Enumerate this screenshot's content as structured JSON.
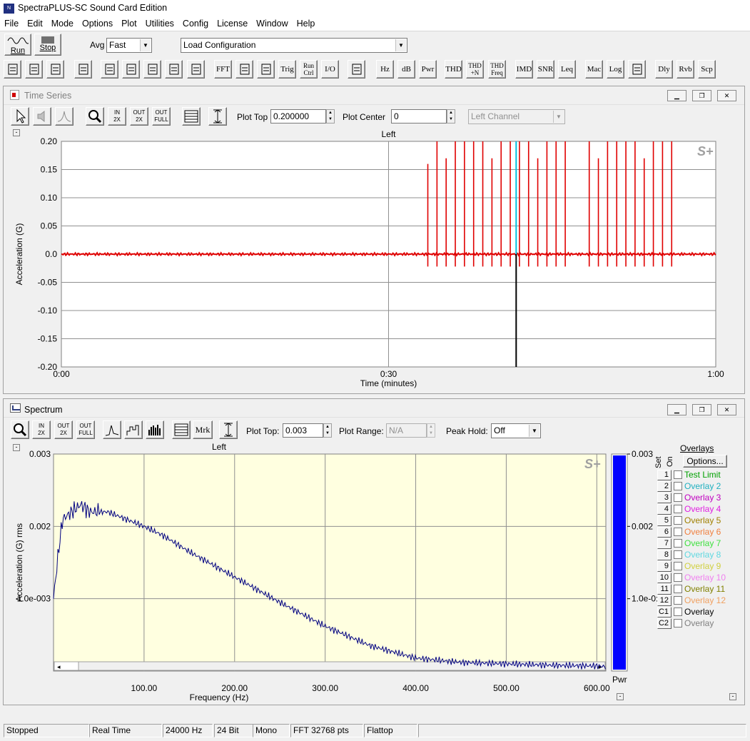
{
  "app": {
    "title": "SpectraPLUS-SC Sound Card Edition"
  },
  "menu": [
    "File",
    "Edit",
    "Mode",
    "Options",
    "Plot",
    "Utilities",
    "Config",
    "License",
    "Window",
    "Help"
  ],
  "toolbar1": {
    "run_label": "Run",
    "stop_label": "Stop",
    "avg_label": "Avg",
    "avg_value": "Fast",
    "config_value": "Load Configuration"
  },
  "toolbar2": [
    {
      "name": "new-icon",
      "label": ""
    },
    {
      "name": "open-icon",
      "label": ""
    },
    {
      "name": "save-icon",
      "label": ""
    },
    {
      "name": "print-icon",
      "label": ""
    },
    {
      "name": "forward-icon",
      "label": ""
    },
    {
      "name": "waveform-edit-icon",
      "label": ""
    },
    {
      "name": "ramp-icon",
      "label": ""
    },
    {
      "name": "spectrogram-icon",
      "label": ""
    },
    {
      "name": "3d-plot-icon",
      "label": ""
    },
    {
      "name": "fft-button",
      "label": "FFT"
    },
    {
      "name": "scope-icon",
      "label": ""
    },
    {
      "name": "phase-icon",
      "label": ""
    },
    {
      "name": "trig-button",
      "label": "Trig"
    },
    {
      "name": "run-ctrl-button",
      "label": "Run Ctrl"
    },
    {
      "name": "io-button",
      "label": "I/O"
    },
    {
      "name": "generator-icon",
      "label": ""
    },
    {
      "name": "hz-button",
      "label": "Hz"
    },
    {
      "name": "db-button",
      "label": "dB"
    },
    {
      "name": "pwr-button",
      "label": "Pwr"
    },
    {
      "name": "thd-button",
      "label": "THD"
    },
    {
      "name": "thd-n-button",
      "label": "THD +N"
    },
    {
      "name": "thd-freq-button",
      "label": "THD Freq"
    },
    {
      "name": "imd-button",
      "label": "IMD"
    },
    {
      "name": "snr-button",
      "label": "SNR"
    },
    {
      "name": "leq-button",
      "label": "Leq"
    },
    {
      "name": "mac-button",
      "label": "Mac"
    },
    {
      "name": "log-button",
      "label": "Log"
    },
    {
      "name": "alarm-icon",
      "label": ""
    },
    {
      "name": "dly-button",
      "label": "Dly"
    },
    {
      "name": "rvb-button",
      "label": "Rvb"
    },
    {
      "name": "scp-button",
      "label": "Scp"
    }
  ],
  "time_series": {
    "window_title": "Time Series",
    "plot_top_label": "Plot Top",
    "plot_top_value": "0.200000",
    "plot_center_label": "Plot Center",
    "plot_center_value": "0",
    "channel_value": "Left Channel",
    "zoom_labels": [
      [
        "IN",
        "2X"
      ],
      [
        "OUT",
        "2X"
      ],
      [
        "OUT",
        "FULL"
      ]
    ],
    "channel_title": "Left",
    "logo": "S+",
    "ylabel": "Acceleration (G)",
    "xlabel": "Time (minutes)",
    "yticks": [
      "0.20",
      "0.15",
      "0.10",
      "0.05",
      "0.0",
      "-0.05",
      "-0.10",
      "-0.15",
      "-0.20"
    ],
    "xticks": [
      "0:00",
      "0:30",
      "1:00"
    ]
  },
  "spectrum": {
    "window_title": "Spectrum",
    "plot_top_label": "Plot Top:",
    "plot_top_value": "0.003",
    "plot_range_label": "Plot Range:",
    "plot_range_value": "N/A",
    "peak_hold_label": "Peak Hold:",
    "peak_hold_value": "Off",
    "marker_label": "Mrk",
    "zoom_labels": [
      [
        "IN",
        "2X"
      ],
      [
        "OUT",
        "2X"
      ],
      [
        "OUT",
        "FULL"
      ]
    ],
    "channel_title": "Left",
    "logo": "S+",
    "ylabel": "Acceleration (G) rms",
    "xlabel": "Frequency (Hz)",
    "yticks": [
      "0.003",
      "0.002",
      "1.0e-003"
    ],
    "xticks": [
      "100.00",
      "200.00",
      "300.00",
      "400.00",
      "500.00",
      "600.00"
    ],
    "pwr_label": "Pwr",
    "pwr_ticks": [
      "0.003",
      "0.002",
      "1.0e-0:"
    ],
    "overlays_title": "Overlays",
    "options_label": "Options...",
    "set_label": "Set",
    "on_label": "On",
    "overlays": [
      {
        "num": "1",
        "name": "Test Limit",
        "color": "#00a000"
      },
      {
        "num": "2",
        "name": "Overlay 2",
        "color": "#20b0c0"
      },
      {
        "num": "3",
        "name": "Overlay 3",
        "color": "#c000c0"
      },
      {
        "num": "4",
        "name": "Overlay 4",
        "color": "#e020e0"
      },
      {
        "num": "5",
        "name": "Overlay 5",
        "color": "#a08000"
      },
      {
        "num": "6",
        "name": "Overlay 6",
        "color": "#f08040"
      },
      {
        "num": "7",
        "name": "Overlay 7",
        "color": "#40e040"
      },
      {
        "num": "8",
        "name": "Overlay 8",
        "color": "#60d8e0"
      },
      {
        "num": "9",
        "name": "Overlay 9",
        "color": "#d0d040"
      },
      {
        "num": "10",
        "name": "Overlay 10",
        "color": "#f080f0"
      },
      {
        "num": "11",
        "name": "Overlay 11",
        "color": "#808000"
      },
      {
        "num": "12",
        "name": "Overlay 12",
        "color": "#f0a060"
      },
      {
        "num": "C1",
        "name": "Overlay",
        "color": "#000000"
      },
      {
        "num": "C2",
        "name": "Overlay",
        "color": "#808080"
      }
    ]
  },
  "status": [
    "Stopped",
    "Real Time",
    "24000 Hz",
    "24 Bit",
    "Mono",
    "FFT 32768 pts",
    "Flattop"
  ],
  "colors": {
    "trace_time": "#e00000",
    "trace_spec": "#000080",
    "spec_bg": "#ffffe0",
    "pwr_bar": "#0000ff",
    "cursor": "#00c0e0"
  },
  "chart_data": [
    {
      "type": "line",
      "ylabel": "Acceleration (G)",
      "xlabel": "Time (minutes)",
      "xlim": [
        0,
        60
      ],
      "ylim": [
        -0.2,
        0.2
      ],
      "series": [
        {
          "x": [
            0,
            33.5,
            33.5,
            36,
            38,
            40,
            42,
            44,
            46,
            48,
            50,
            52,
            54,
            56,
            58,
            60
          ],
          "y": [
            0,
            0,
            0.16,
            0.2,
            0.2,
            0.2,
            0.2,
            0.2,
            0.2,
            0.2,
            0.2,
            0.2,
            0.2,
            0.2,
            0.2,
            0
          ]
        }
      ],
      "cursor_x": 41.7
    },
    {
      "type": "line",
      "ylabel": "Acceleration (G) rms",
      "xlabel": "Frequency (Hz)",
      "xlim": [
        0,
        610
      ],
      "ylim": [
        0,
        0.003
      ],
      "series": [
        {
          "x": [
            0,
            5,
            10,
            20,
            30,
            40,
            60,
            80,
            100,
            120,
            150,
            200,
            250,
            300,
            350,
            400,
            450,
            500,
            550,
            600,
            610
          ],
          "y": [
            0.001,
            0.0016,
            0.0021,
            0.0022,
            0.0023,
            0.0022,
            0.0022,
            0.0021,
            0.002,
            0.00188,
            0.00165,
            0.0013,
            0.00095,
            0.00062,
            0.00035,
            0.00018,
            0.00012,
            0.0001,
            8e-05,
            7e-05,
            6e-05
          ]
        }
      ]
    }
  ]
}
